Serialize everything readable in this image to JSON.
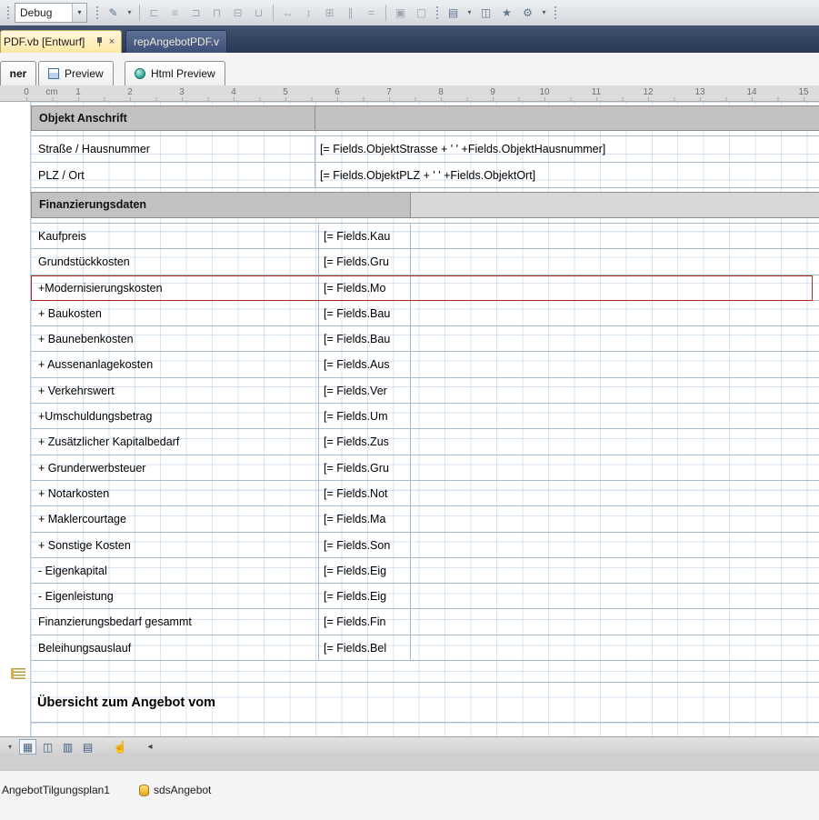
{
  "toolbar": {
    "debug_label": "Debug"
  },
  "icon_glyphs": {
    "pen": "✎",
    "align_left": "⊏",
    "align_center": "≡",
    "align_right": "⊐",
    "align_top": "⊓",
    "align_middle": "⊟",
    "align_bottom": "⊔",
    "same_width": "↔",
    "same_height": "↕",
    "same_size": "⊞",
    "space_across": "∥",
    "space_down": "=",
    "bring_front": "▣",
    "send_back": "▢",
    "new_doc": "▤",
    "copy": "◫",
    "wizard": "★",
    "settings": "⚙",
    "caret": "▾",
    "close": "×",
    "grid_view": "▦",
    "split_view": "◫",
    "list_view": "▥",
    "page_view": "▤",
    "hand": "☝",
    "scroll_left": "◂"
  },
  "document_tabs": {
    "active_label": "PDF.vb [Entwurf]",
    "inactive_label": "repAngebotPDF.vb"
  },
  "designer_tabs": {
    "tab1": "ner",
    "tab2": "Preview",
    "tab3": "Html Preview"
  },
  "ruler": {
    "marks": [
      "0",
      "cm",
      "1",
      "2",
      "3",
      "4",
      "5",
      "6",
      "7",
      "8",
      "9",
      "10",
      "11",
      "12",
      "13",
      "14",
      "15"
    ]
  },
  "report": {
    "address_section": {
      "header": "Objekt Anschrift",
      "rows": [
        {
          "label": "Straße / Hausnummer",
          "expression": "[= Fields.ObjektStrasse + ' ' +Fields.ObjektHausnummer]"
        },
        {
          "label": "PLZ / Ort",
          "expression": "[= Fields.ObjektPLZ + ' ' +Fields.ObjektOrt]"
        }
      ]
    },
    "finance_section": {
      "header": "Finanzierungsdaten",
      "rows": [
        {
          "label": "Kaufpreis",
          "expression": "[= Fields.Kau",
          "selected": false
        },
        {
          "label": "Grundstückkosten",
          "expression": "[= Fields.Gru",
          "selected": false
        },
        {
          "label": "+Modernisierungskosten",
          "expression": "[= Fields.Mo",
          "selected": true
        },
        {
          "label": "+ Baukosten",
          "expression": "[= Fields.Bau",
          "selected": false
        },
        {
          "label": "+ Baunebenkosten",
          "expression": "[= Fields.Bau",
          "selected": false
        },
        {
          "label": "+ Aussenanlagekosten",
          "expression": "[= Fields.Aus",
          "selected": false
        },
        {
          "label": "+ Verkehrswert",
          "expression": "[= Fields.Ver",
          "selected": false
        },
        {
          "label": "+Umschuldungsbetrag",
          "expression": "[= Fields.Um",
          "selected": false
        },
        {
          "label": "+ Zusätzlicher Kapitalbedarf",
          "expression": "[= Fields.Zus",
          "selected": false
        },
        {
          "label": "+ Grunderwerbsteuer",
          "expression": "[= Fields.Gru",
          "selected": false
        },
        {
          "label": "+ Notarkosten",
          "expression": "[= Fields.Not",
          "selected": false
        },
        {
          "label": "+ Maklercourtage",
          "expression": "[= Fields.Ma",
          "selected": false
        },
        {
          "label": "+ Sonstige Kosten",
          "expression": "[= Fields.Son",
          "selected": false
        },
        {
          "label": "- Eigenkapital",
          "expression": "[= Fields.Eig",
          "selected": false
        },
        {
          "label": "- Eigenleistung",
          "expression": "[= Fields.Eig",
          "selected": false
        },
        {
          "label": "Finanzierungsbedarf gesammt",
          "expression": "[= Fields.Fin",
          "selected": false
        },
        {
          "label": "Beleihungsauslauf",
          "expression": "[= Fields.Bel",
          "selected": false
        }
      ]
    },
    "footer_heading": "Übersicht zum Angebot vom"
  },
  "tray": {
    "item1": "AngebotTilgungsplan1",
    "item2": "sdsAngebot"
  }
}
